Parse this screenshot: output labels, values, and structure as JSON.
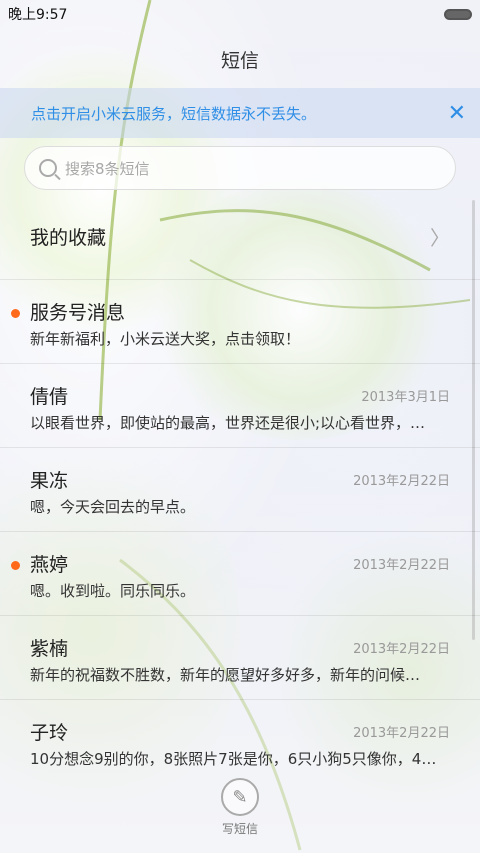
{
  "status_bar": {
    "time": "晚上9:57"
  },
  "header": {
    "title": "短信"
  },
  "cloud_banner": {
    "text": "点击开启小米云服务，短信数据永不丢失。",
    "close_icon": "close-icon"
  },
  "search": {
    "placeholder": "搜索8条短信"
  },
  "favorites": {
    "label": "我的收藏"
  },
  "messages": [
    {
      "sender": "服务号消息",
      "date": "",
      "preview": "新年新福利，小米云送大奖，点击领取！",
      "unread": true
    },
    {
      "sender": "倩倩",
      "date": "2013年3月1日",
      "preview": "以眼看世界，即使站的最高，世界还是很小;以心看世界，…",
      "unread": false
    },
    {
      "sender": "果冻",
      "date": "2013年2月22日",
      "preview": "嗯，今天会回去的早点。",
      "unread": false
    },
    {
      "sender": "燕婷",
      "date": "2013年2月22日",
      "preview": "嗯。收到啦。同乐同乐。",
      "unread": true
    },
    {
      "sender": "紫楠",
      "date": "2013年2月22日",
      "preview": "新年的祝福数不胜数，新年的愿望好多好多，新年的问候…",
      "unread": false
    },
    {
      "sender": "子玲",
      "date": "2013年2月22日",
      "preview": "10分想念9别的你，8张照片7张是你，6只小狗5只像你，4…",
      "unread": false
    }
  ],
  "compose": {
    "label": "写短信"
  },
  "colors": {
    "accent": "#2f8ee6",
    "unread_dot": "#ff6a1a"
  }
}
